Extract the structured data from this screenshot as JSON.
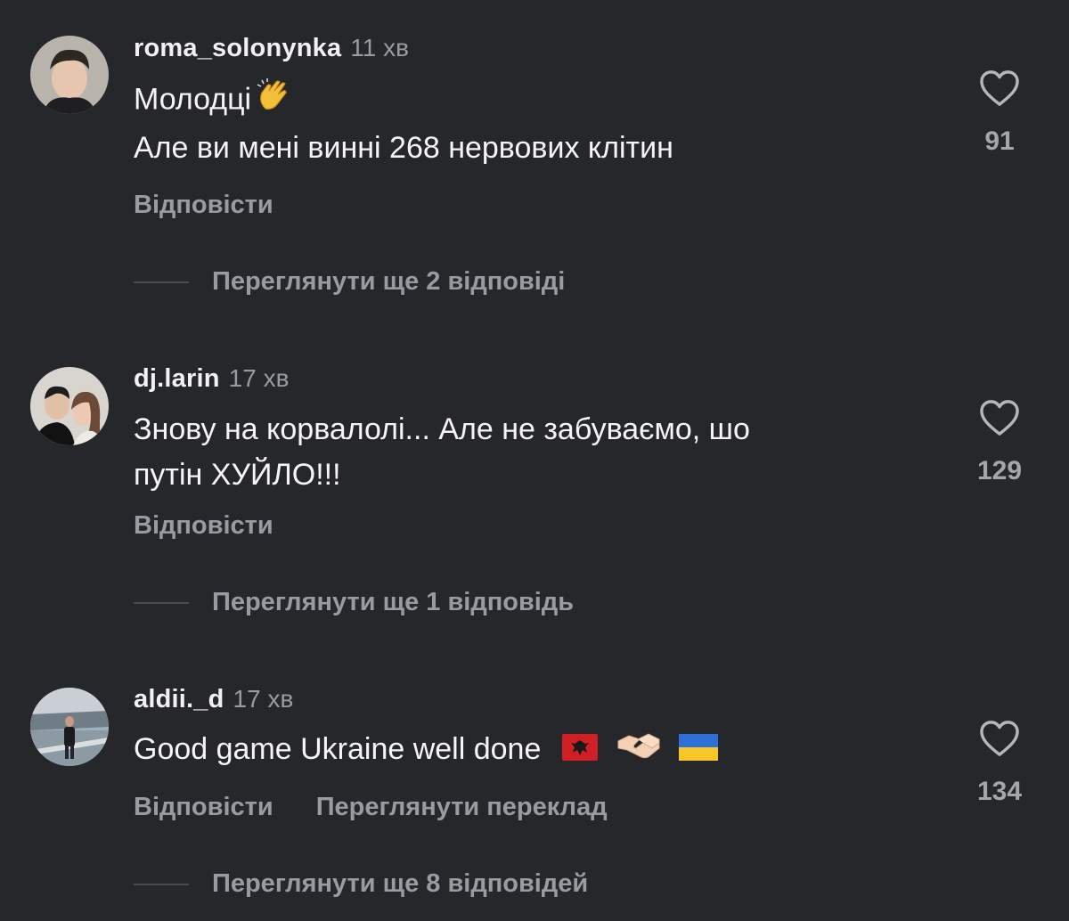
{
  "comments": [
    {
      "username": "roma_solonynka",
      "time": "11 хв",
      "lines": [
        "Молодці",
        "Але ви мені винні 268 нервових клітин"
      ],
      "emoji": "clapping-hands-icon",
      "reply_label": "Відповісти",
      "likes": "91",
      "view_replies": "Переглянути ще 2 відповіді"
    },
    {
      "username": "dj.larin",
      "time": "17 хв",
      "lines": [
        "Знову на корвалолі... Але не забуваємо, шо",
        "путін ХУЙЛО!!!"
      ],
      "reply_label": "Відповісти",
      "likes": "129",
      "view_replies": "Переглянути ще 1 відповідь"
    },
    {
      "username": "aldii._d",
      "time": "17 хв",
      "lines": [
        "Good game Ukraine well done"
      ],
      "emojis": [
        "albania-flag-icon",
        "handshake-icon",
        "ukraine-flag-icon"
      ],
      "reply_label": "Відповісти",
      "translate_label": "Переглянути переклад",
      "likes": "134",
      "view_replies": "Переглянути ще 8 відповідей"
    }
  ],
  "colors": {
    "background": "#26272b",
    "primary_text": "#f5f5f5",
    "secondary_text": "#9a9ba0"
  }
}
